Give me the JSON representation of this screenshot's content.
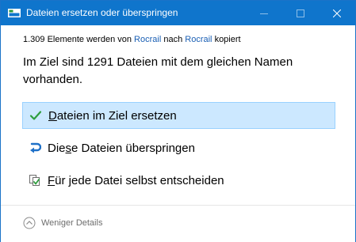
{
  "window": {
    "title": "Dateien ersetzen oder überspringen"
  },
  "subline": {
    "prefix": "1.309 Elemente werden von",
    "source": "Rocrail",
    "middle": "nach",
    "destination": "Rocrail",
    "suffix": "kopiert"
  },
  "heading": "Im Ziel sind 1291 Dateien mit dem gleichen Namen vorhanden.",
  "options": [
    {
      "label_hotkey": "D",
      "label_rest": "ateien im Ziel ersetzen",
      "icon": "checkmark-icon",
      "selected": true
    },
    {
      "label_before": "Die",
      "label_hotkey": "s",
      "label_after": "e Dateien überspringen",
      "icon": "skip-arrow-icon",
      "selected": false
    },
    {
      "label_hotkey": "F",
      "label_rest": "ür jede Datei selbst entscheiden",
      "icon": "decide-files-icon",
      "selected": false
    }
  ],
  "footer": {
    "details_label": "Weniger Details",
    "icon": "chevron-up-circle-icon"
  },
  "colors": {
    "titlebar": "#0f75cc",
    "selected_bg": "#cce8ff",
    "selected_border": "#99d1ff",
    "link": "#1a5fb4",
    "check": "#2e9e3e",
    "skip_arrow": "#1e70c8"
  }
}
